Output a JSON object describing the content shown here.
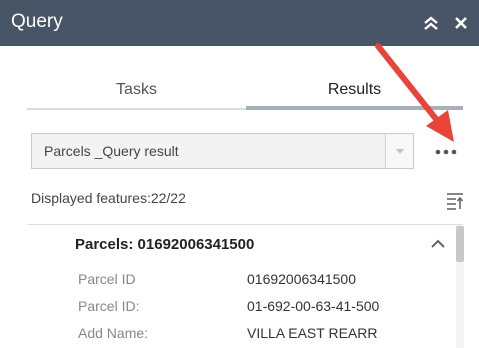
{
  "panel": {
    "title": "Query"
  },
  "tabs": [
    {
      "label": "Tasks"
    },
    {
      "label": "Results"
    }
  ],
  "result_select": {
    "selected": "Parcels _Query result"
  },
  "displayed_features": "Displayed features:22/22",
  "result": {
    "header": "Parcels: 01692006341500",
    "attributes": [
      {
        "label": "Parcel ID",
        "value": "01692006341500"
      },
      {
        "label": "Parcel ID:",
        "value": "01-692-00-63-41-500"
      },
      {
        "label": "Add Name:",
        "value": "VILLA EAST REARR"
      }
    ]
  },
  "icons": {
    "collapse": "double-chevron-up-icon",
    "close": "close-icon",
    "more": "ellipsis-icon",
    "sort": "sort-icon",
    "dropdown": "caret-down-icon",
    "result_collapse": "chevron-up-icon"
  },
  "colors": {
    "titlebar": "#485566",
    "annotation_arrow": "#e8443a",
    "active_tab_underline": "#a8b0ba"
  }
}
